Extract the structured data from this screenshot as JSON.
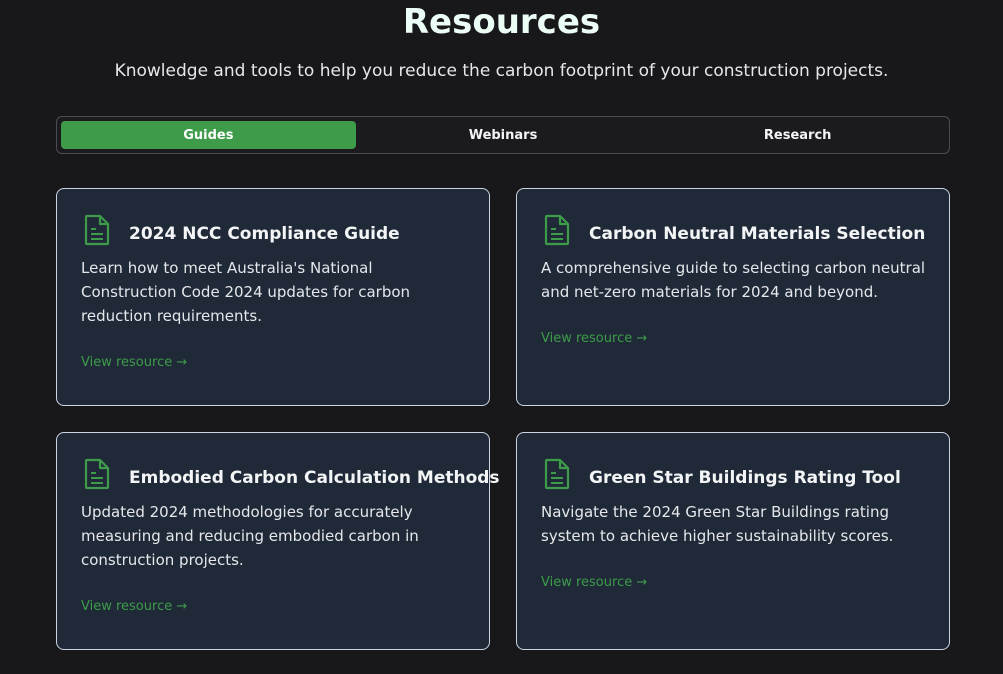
{
  "header": {
    "title": "Resources",
    "subtitle": "Knowledge and tools to help you reduce the carbon footprint of your construction projects."
  },
  "tabs": [
    {
      "label": "Guides",
      "active": true
    },
    {
      "label": "Webinars",
      "active": false
    },
    {
      "label": "Research",
      "active": false
    }
  ],
  "cards": [
    {
      "icon": "document-icon",
      "title": "2024 NCC Compliance Guide",
      "description": "Learn how to meet Australia's National Construction Code 2024 updates for carbon reduction requirements.",
      "link": "View resource →"
    },
    {
      "icon": "document-icon",
      "title": "Carbon Neutral Materials Selection",
      "description": "A comprehensive guide to selecting carbon neutral and net-zero materials for 2024 and beyond.",
      "link": "View resource →"
    },
    {
      "icon": "document-icon",
      "title": "Embodied Carbon Calculation Methods",
      "description": "Updated 2024 methodologies for accurately measuring and reducing embodied carbon in construction projects.",
      "link": "View resource →"
    },
    {
      "icon": "document-icon",
      "title": "Green Star Buildings Rating Tool",
      "description": "Navigate the 2024 Green Star Buildings rating system to achieve higher sustainability scores.",
      "link": "View resource →"
    }
  ],
  "colors": {
    "background": "#18181b",
    "card_background": "#1f2937",
    "accent": "#3d9b4a",
    "title_text": "#ecfdf5"
  }
}
